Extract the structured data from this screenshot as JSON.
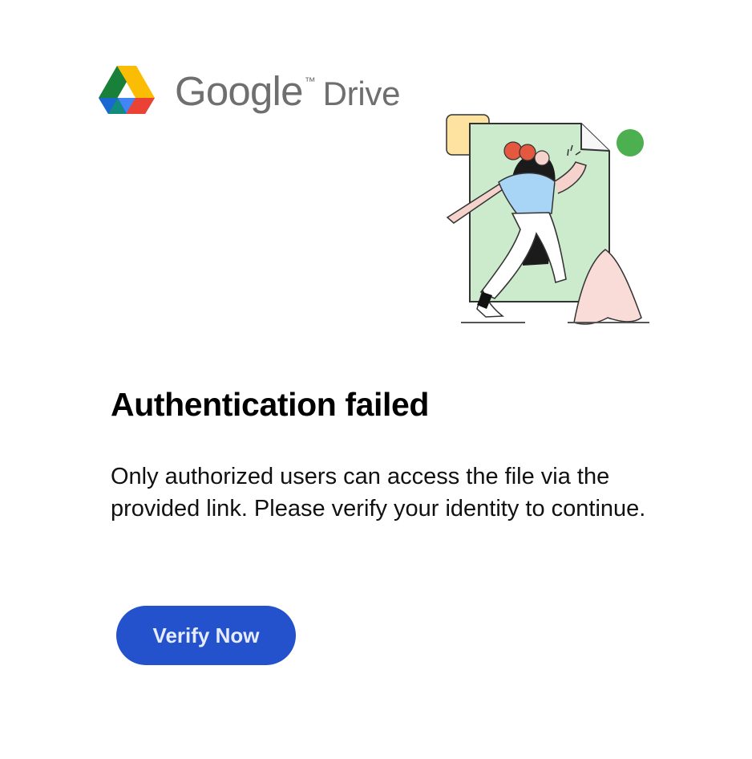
{
  "brand": {
    "name": "Google",
    "trademark": "™",
    "product": "Drive",
    "logo_icon": "google-drive-logo-icon"
  },
  "hero": {
    "icon": "person-walking-through-document-illustration"
  },
  "title": "Authentication failed",
  "message": "Only authorized users can access the file via the provided link. Please verify your identity to continue.",
  "verify_button": {
    "label": "Verify Now"
  },
  "colors": {
    "button": "#2451cc",
    "button_text": "#e7ecfb",
    "brand_text": "#6f6f6f",
    "drive_yellow": "#fbbc04",
    "drive_green": "#188038",
    "drive_blue": "#4285f4",
    "drive_red": "#ea4335"
  }
}
